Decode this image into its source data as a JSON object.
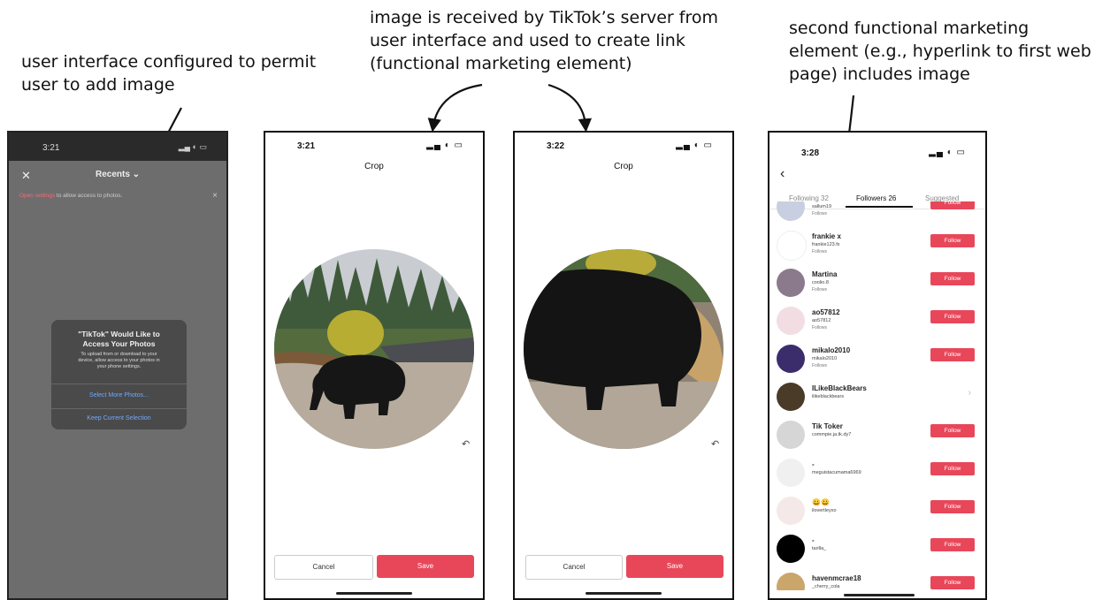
{
  "captions": {
    "left_line1": "user interface configured to permit",
    "left_line2": "user to add image",
    "mid_line1": "image is received by TikTok’s server from",
    "mid_line2": "user interface and used to create link",
    "mid_line3": "(functional marketing element)",
    "right_line1": "second functional marketing",
    "right_line2": "element (e.g., hyperlink to first web",
    "right_line3": "page) includes image"
  },
  "phone1": {
    "time": "3:21",
    "close": "✕",
    "album": "Recents ⌄",
    "settings_link": "Open settings",
    "settings_text": " to allow access to photos.",
    "dismiss": "×",
    "dialog_title_1": "\"TikTok\" Would Like to",
    "dialog_title_2": "Access Your Photos",
    "dialog_body_1": "To upload from or download to your",
    "dialog_body_2": "device, allow access to your photos in",
    "dialog_body_3": "your phone settings.",
    "select_more": "Select More Photos...",
    "keep_current": "Keep Current Selection"
  },
  "phone2": {
    "time": "3:21",
    "title": "Crop",
    "cancel": "Cancel",
    "save": "Save",
    "rotate": "↶"
  },
  "phone3": {
    "time": "3:22",
    "title": "Crop",
    "cancel": "Cancel",
    "save": "Save",
    "rotate": "↶"
  },
  "phone4": {
    "time": "3:28",
    "back": "‹",
    "tabs": [
      "Following 32",
      "Followers 26",
      "Suggested"
    ],
    "rows": [
      {
        "name": "",
        "handle": "sallum19",
        "followers": "Follows",
        "button": "Follow"
      },
      {
        "name": "frankie x",
        "handle": "frankie123.fx",
        "followers": "Follows",
        "button": "Follow"
      },
      {
        "name": "Martina",
        "handle": "coolio.8",
        "followers": "Follows",
        "button": "Follow"
      },
      {
        "name": "ao57812",
        "handle": "ao57812",
        "followers": "Follows",
        "button": "Follow"
      },
      {
        "name": "mikalo2010",
        "handle": "mikalo2010",
        "followers": "Follows",
        "button": "Follow"
      },
      {
        "name": "ILikeBlackBears",
        "handle": "ilikeblackbears",
        "followers": "",
        "button": ""
      },
      {
        "name": "Tik Toker",
        "handle": "commpie.ja.tk.dy7",
        "followers": "",
        "button": "Follow"
      },
      {
        "name": "-",
        "handle": "meguistacumama6969",
        "followers": "",
        "button": "Follow"
      },
      {
        "name": "😀😀",
        "handle": "ilovertleyxo",
        "followers": "",
        "button": "Follow"
      },
      {
        "name": "-",
        "handle": "tarilla_",
        "followers": "",
        "button": "Follow"
      },
      {
        "name": "havenmcrae18",
        "handle": "_cherry_cola",
        "followers": "",
        "button": "Follow"
      }
    ]
  },
  "colors": {
    "tiktok_red": "#e8475a",
    "dim_overlay": "#6d6d6d"
  }
}
